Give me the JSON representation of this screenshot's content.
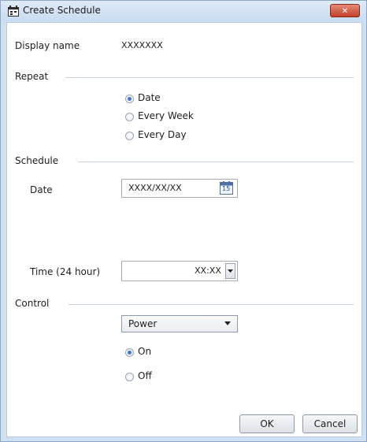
{
  "window": {
    "title": "Create Schedule",
    "close_glyph": "✕"
  },
  "display_name": {
    "label": "Display name",
    "value": "XXXXXXX"
  },
  "repeat": {
    "label": "Repeat",
    "options": [
      {
        "label": "Date",
        "selected": true
      },
      {
        "label": "Every Week",
        "selected": false
      },
      {
        "label": "Every Day",
        "selected": false
      }
    ]
  },
  "schedule": {
    "label": "Schedule",
    "date_label": "Date",
    "date_value": "XXXX/XX/XX",
    "calendar_day": "15",
    "time_label": "Time (24 hour)",
    "time_value": "XX:XX"
  },
  "control": {
    "label": "Control",
    "select_value": "Power",
    "options": [
      {
        "label": "On",
        "selected": true
      },
      {
        "label": "Off",
        "selected": false
      }
    ]
  },
  "buttons": {
    "ok": "OK",
    "cancel": "Cancel"
  }
}
